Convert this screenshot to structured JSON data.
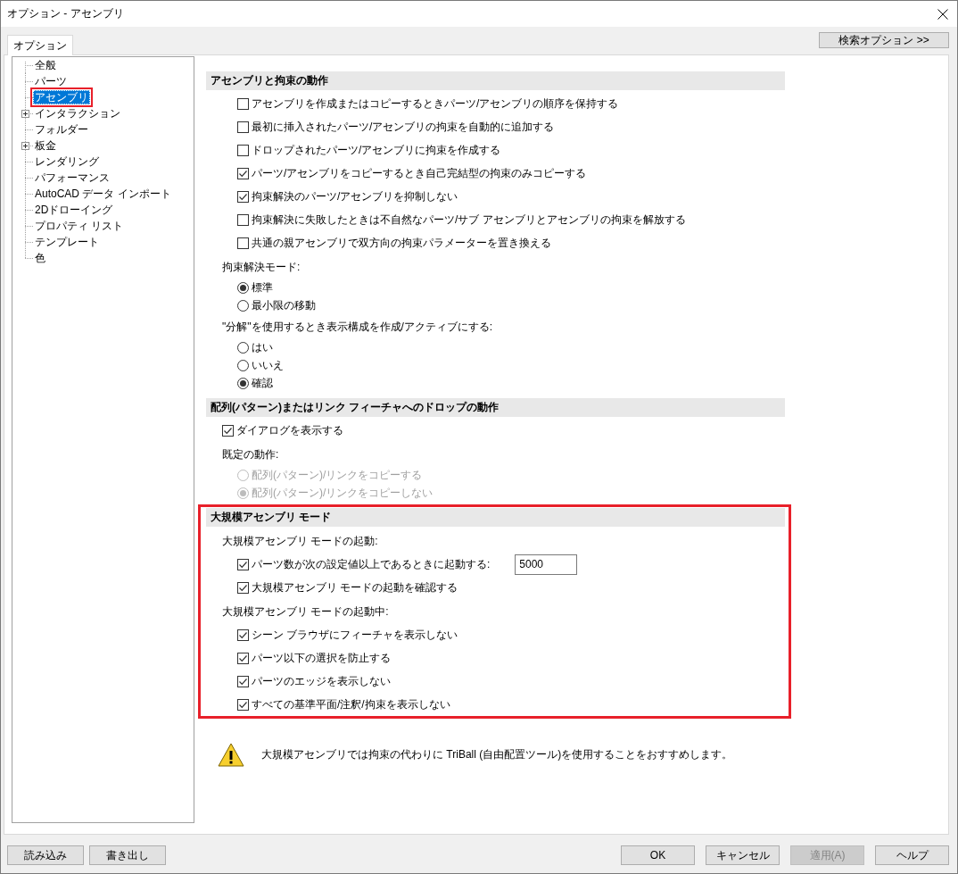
{
  "window": {
    "title": "オプション - アセンブリ"
  },
  "tabs": [
    {
      "label": "オプション",
      "selected": true
    }
  ],
  "search_button": {
    "label": "検索オプション >>"
  },
  "tree": {
    "items": [
      {
        "label": "全般",
        "kind": "leaf",
        "selected": false,
        "highlighted": false
      },
      {
        "label": "パーツ",
        "kind": "leaf",
        "selected": false,
        "highlighted": false
      },
      {
        "label": "アセンブリ",
        "kind": "leaf",
        "selected": true,
        "highlighted": true
      },
      {
        "label": "インタラクション",
        "kind": "collapsed",
        "selected": false,
        "highlighted": false
      },
      {
        "label": "フォルダー",
        "kind": "leaf",
        "selected": false,
        "highlighted": false
      },
      {
        "label": "板金",
        "kind": "collapsed",
        "selected": false,
        "highlighted": false
      },
      {
        "label": "レンダリング",
        "kind": "leaf",
        "selected": false,
        "highlighted": false
      },
      {
        "label": "パフォーマンス",
        "kind": "leaf",
        "selected": false,
        "highlighted": false
      },
      {
        "label": "AutoCAD データ インポート",
        "kind": "leaf",
        "selected": false,
        "highlighted": false
      },
      {
        "label": "2Dドローイング",
        "kind": "leaf",
        "selected": false,
        "highlighted": false
      },
      {
        "label": "プロパティ リスト",
        "kind": "leaf",
        "selected": false,
        "highlighted": false
      },
      {
        "label": "テンプレート",
        "kind": "leaf",
        "selected": false,
        "highlighted": false
      },
      {
        "label": "色",
        "kind": "leaf",
        "selected": false,
        "highlighted": false
      }
    ]
  },
  "sections": [
    {
      "title": "アセンブリと拘束の動作",
      "highlighted": false,
      "items": [
        {
          "kind": "group",
          "options": [
            {
              "kind": "checkbox",
              "label": "アセンブリを作成またはコピーするときパーツ/アセンブリの順序を保持する",
              "checked": false,
              "disabled": false
            },
            {
              "kind": "checkbox",
              "label": "最初に挿入されたパーツ/アセンブリの拘束を自動的に追加する",
              "checked": false,
              "disabled": false
            },
            {
              "kind": "checkbox",
              "label": "ドロップされたパーツ/アセンブリに拘束を作成する",
              "checked": false,
              "disabled": false
            },
            {
              "kind": "checkbox",
              "label": "パーツ/アセンブリをコピーするとき自己完結型の拘束のみコピーする",
              "checked": true,
              "disabled": false
            },
            {
              "kind": "checkbox",
              "label": "拘束解決のパーツ/アセンブリを抑制しない",
              "checked": true,
              "disabled": false
            },
            {
              "kind": "checkbox",
              "label": "拘束解決に失敗したときは不自然なパーツ/サブ アセンブリとアセンブリの拘束を解放する",
              "checked": false,
              "disabled": false
            },
            {
              "kind": "checkbox",
              "label": "共通の親アセンブリで双方向の拘束パラメーターを置き換える",
              "checked": false,
              "disabled": false
            }
          ]
        },
        {
          "kind": "group",
          "label": "拘束解決モード:",
          "options": [
            {
              "kind": "radio",
              "label": "標準",
              "selected": true,
              "disabled": false
            },
            {
              "kind": "radio",
              "label": "最小限の移動",
              "selected": false,
              "disabled": false
            }
          ]
        },
        {
          "kind": "group",
          "label": "\"分解\"を使用するとき表示構成を作成/アクティブにする:",
          "options": [
            {
              "kind": "radio",
              "label": "はい",
              "selected": false,
              "disabled": false
            },
            {
              "kind": "radio",
              "label": "いいえ",
              "selected": false,
              "disabled": false
            },
            {
              "kind": "radio",
              "label": "確認",
              "selected": true,
              "disabled": false
            }
          ]
        }
      ]
    },
    {
      "title": "配列(パターン)またはリンク フィーチャへのドロップの動作",
      "highlighted": false,
      "items": [
        {
          "kind": "checkbox",
          "label": "ダイアログを表示する",
          "checked": true,
          "disabled": false
        },
        {
          "kind": "group",
          "label": "既定の動作:",
          "options": [
            {
              "kind": "radio",
              "label": "配列(パターン)/リンクをコピーする",
              "selected": false,
              "disabled": true
            },
            {
              "kind": "radio",
              "label": "配列(パターン)/リンクをコピーしない",
              "selected": true,
              "disabled": true
            }
          ]
        }
      ]
    },
    {
      "title": "大規模アセンブリ モード",
      "highlighted": true,
      "items": [
        {
          "kind": "group",
          "label": "大規模アセンブリ モードの起動:",
          "options": [
            {
              "kind": "checkbox-input",
              "label": "パーツ数が次の設定値以上であるときに起動する:",
              "checked": true,
              "disabled": false,
              "value": "5000"
            },
            {
              "kind": "checkbox",
              "label": "大規模アセンブリ モードの起動を確認する",
              "checked": true,
              "disabled": false
            }
          ]
        },
        {
          "kind": "group",
          "label": "大規模アセンブリ モードの起動中:",
          "options": [
            {
              "kind": "checkbox",
              "label": "シーン ブラウザにフィーチャを表示しない",
              "checked": true,
              "disabled": false
            },
            {
              "kind": "checkbox",
              "label": "パーツ以下の選択を防止する",
              "checked": true,
              "disabled": false
            },
            {
              "kind": "checkbox",
              "label": "パーツのエッジを表示しない",
              "checked": true,
              "disabled": false
            },
            {
              "kind": "checkbox",
              "label": "すべての基準平面/注釈/拘束を表示しない",
              "checked": true,
              "disabled": false
            }
          ]
        }
      ]
    }
  ],
  "note": {
    "text": "大規模アセンブリでは拘束の代わりに TriBall (自由配置ツール)を使用することをおすすめします。"
  },
  "footer": {
    "left_buttons": [
      {
        "label": "読み込み",
        "disabled": false
      },
      {
        "label": "書き出し",
        "disabled": false
      }
    ],
    "right_buttons": [
      {
        "label": "OK",
        "disabled": false
      },
      {
        "label": "キャンセル",
        "disabled": false
      },
      {
        "label": "適用(A)",
        "disabled": true
      },
      {
        "label": "ヘルプ",
        "disabled": false
      }
    ]
  }
}
